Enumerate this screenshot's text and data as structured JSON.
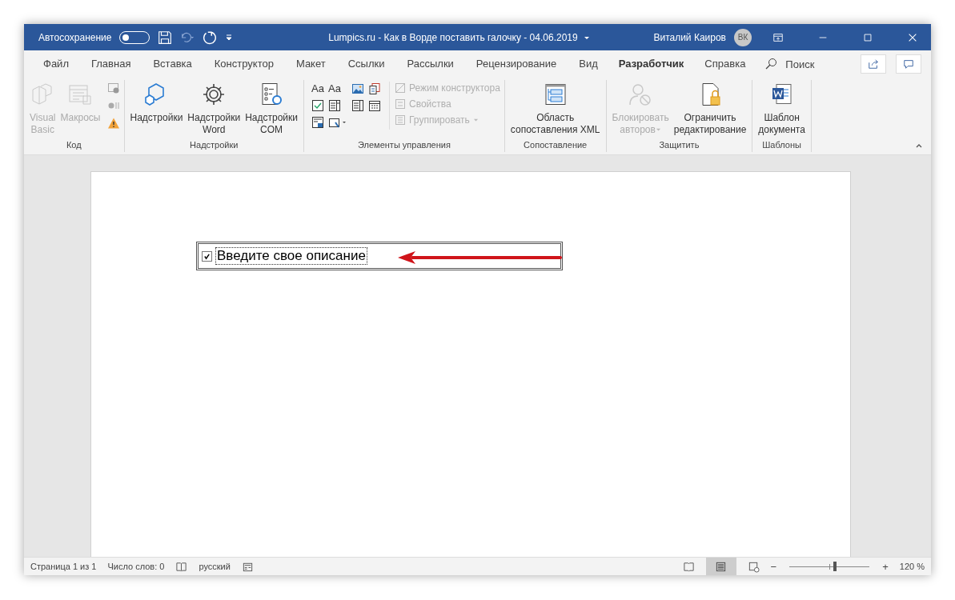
{
  "title_bar": {
    "autosave_label": "Автосохранение",
    "autosave_on": false,
    "title": "Lumpics.ru - Как в Ворде поставить галочку  -  04.06.2019",
    "user_name": "Виталий Каиров",
    "avatar_initials": "ВК"
  },
  "tabs": [
    {
      "label": "Файл",
      "selected": false
    },
    {
      "label": "Главная",
      "selected": false
    },
    {
      "label": "Вставка",
      "selected": false
    },
    {
      "label": "Конструктор",
      "selected": false
    },
    {
      "label": "Макет",
      "selected": false
    },
    {
      "label": "Ссылки",
      "selected": false
    },
    {
      "label": "Рассылки",
      "selected": false
    },
    {
      "label": "Рецензирование",
      "selected": false
    },
    {
      "label": "Вид",
      "selected": false
    },
    {
      "label": "Разработчик",
      "selected": true
    },
    {
      "label": "Справка",
      "selected": false
    }
  ],
  "search": {
    "placeholder": "Поиск"
  },
  "ribbon": {
    "groups": [
      {
        "name": "Код",
        "buttons": [
          {
            "kind": "vb",
            "lines": [
              "Visual",
              "Basic"
            ],
            "disabled": true
          },
          {
            "kind": "macros",
            "lines": [
              "Макросы"
            ],
            "disabled": true
          }
        ]
      },
      {
        "name": "Надстройки",
        "buttons": [
          {
            "kind": "addins",
            "lines": [
              "Надстройки"
            ],
            "disabled": false
          },
          {
            "kind": "word-addins",
            "lines": [
              "Надстройки",
              "Word"
            ],
            "disabled": false
          },
          {
            "kind": "com-addins",
            "lines": [
              "Надстройки",
              "COM"
            ],
            "disabled": false
          }
        ]
      },
      {
        "name": "Элементы управления",
        "control_labels": [
          "Aa",
          "Aa"
        ],
        "small": [
          {
            "kind": "design",
            "label": "Режим конструктора",
            "disabled": true
          },
          {
            "kind": "props",
            "label": "Свойства",
            "disabled": true
          },
          {
            "kind": "group",
            "label": "Группировать",
            "disabled": true
          }
        ]
      },
      {
        "name": "Сопоставление",
        "buttons": [
          {
            "kind": "xml",
            "lines": [
              "Область",
              "сопоставления XML"
            ],
            "disabled": false
          }
        ]
      },
      {
        "name": "Защитить",
        "buttons": [
          {
            "kind": "block",
            "lines": [
              "Блокировать",
              "авторов"
            ],
            "disabled": true,
            "dropdown": true
          },
          {
            "kind": "restrict",
            "lines": [
              "Ограничить",
              "редактирование"
            ],
            "disabled": false
          }
        ]
      },
      {
        "name": "Шаблоны",
        "buttons": [
          {
            "kind": "template",
            "lines": [
              "Шаблон",
              "документа"
            ],
            "disabled": false
          }
        ]
      }
    ]
  },
  "document": {
    "checkbox_checked": true,
    "content_control_text": "Введите свое описание"
  },
  "status_bar": {
    "page": "Страница 1 из 1",
    "words": "Число слов: 0",
    "language": "русский",
    "zoom": "120 %",
    "zoom_out": "−",
    "zoom_in": "+",
    "zoom_slider": {
      "level": 0.55
    }
  }
}
